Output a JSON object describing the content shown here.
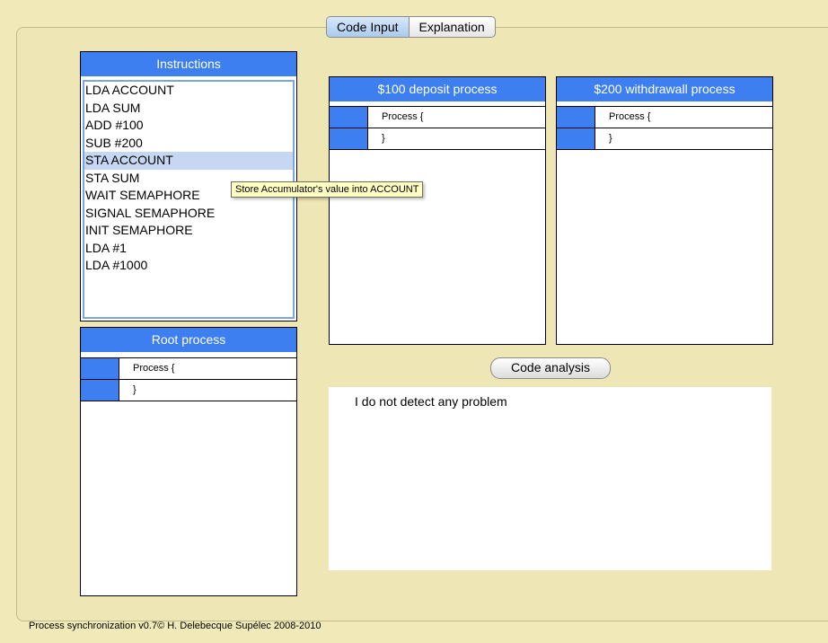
{
  "tabs": [
    {
      "label": "Code Input",
      "active": true
    },
    {
      "label": "Explanation",
      "active": false
    }
  ],
  "instructions": {
    "title": "Instructions",
    "items": [
      "LDA ACCOUNT",
      "LDA SUM",
      "ADD #100",
      "SUB #200",
      "STA ACCOUNT",
      "STA SUM",
      "WAIT SEMAPHORE",
      "SIGNAL SEMAPHORE",
      "INIT SEMAPHORE",
      "LDA #1",
      "LDA #1000"
    ],
    "selected_index": 4
  },
  "tooltip": "Store Accumulator's value into ACCOUNT",
  "root_process": {
    "title": "Root process",
    "lines": [
      "Process {",
      "}"
    ]
  },
  "deposit_process": {
    "title": "$100 deposit process",
    "lines": [
      "Process {",
      "}"
    ]
  },
  "withdrawal_process": {
    "title": "$200 withdrawall process",
    "lines": [
      "Process {",
      "}"
    ]
  },
  "analysis": {
    "button_label": "Code analysis",
    "result_text": "I do not detect any problem"
  },
  "footer": "Process synchronization v0.7© H. Delebecque Supélec 2008-2010",
  "colors": {
    "background": "#f1eab8",
    "header_blue": "#3d7ff0",
    "selection": "#c5d7f2",
    "tooltip": "#ffffc4"
  }
}
